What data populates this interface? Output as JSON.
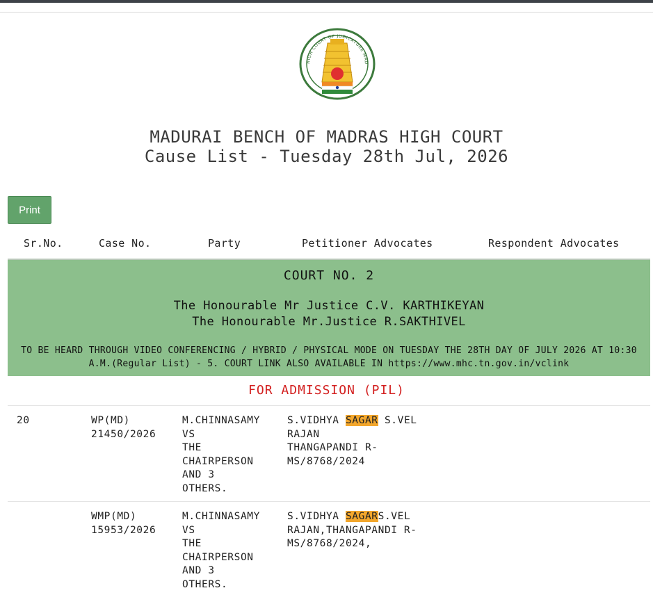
{
  "header": {
    "court_name": "MADURAI BENCH OF MADRAS HIGH COURT",
    "list_title": "Cause List - Tuesday 28th Jul, 2026",
    "emblem_text": "HIGH COURT OF JUDICATURE MADRAS"
  },
  "toolbar": {
    "print_label": "Print"
  },
  "columns": {
    "sr_no": "Sr.No.",
    "case_no": "Case No.",
    "party": "Party",
    "petitioner_advocates": "Petitioner Advocates",
    "respondent_advocates": "Respondent Advocates"
  },
  "court": {
    "court_no": "COURT NO. 2",
    "judge_1": "The Honourable Mr Justice C.V. KARTHIKEYAN",
    "judge_2": "The Honourable Mr.Justice R.SAKTHIVEL",
    "note": "TO BE HEARD THROUGH VIDEO CONFERENCING / HYBRID / PHYSICAL MODE ON TUESDAY THE 28TH DAY OF JULY 2026 AT 10:30 A.M.(Regular List) - 5. COURT LINK ALSO AVAILABLE IN https://www.mhc.tn.gov.in/vclink"
  },
  "section": {
    "title": "FOR ADMISSION (PIL)"
  },
  "rows": [
    {
      "sr_no": "20",
      "case_type": "WP(MD)",
      "case_number": "21450/2026",
      "party": [
        "M.CHINNASAMY",
        "VS",
        "THE",
        "CHAIRPERSON",
        "AND 3",
        "OTHERS."
      ],
      "pet_pre": "S.VIDHYA ",
      "pet_highlight": "SAGAR",
      "pet_post": " S.VEL",
      "pet_lines": [
        "RAJAN",
        "THANGAPANDI R-",
        "MS/8768/2024"
      ],
      "respondent": ""
    },
    {
      "sr_no": "",
      "case_type": "WMP(MD)",
      "case_number": "15953/2026",
      "party": [
        "M.CHINNASAMY",
        "VS",
        "THE",
        "CHAIRPERSON",
        "AND 3",
        "OTHERS."
      ],
      "pet_pre": "S.VIDHYA ",
      "pet_highlight": "SAGAR",
      "pet_post": "S.VEL",
      "pet_lines": [
        "RAJAN,THANGAPANDI R-",
        "MS/8768/2024,"
      ],
      "respondent": ""
    }
  ],
  "colors": {
    "court_block_bg": "#8cbf8c",
    "print_button_bg": "#62a36b",
    "section_title": "#d32020",
    "highlight": "#f3a72d"
  }
}
